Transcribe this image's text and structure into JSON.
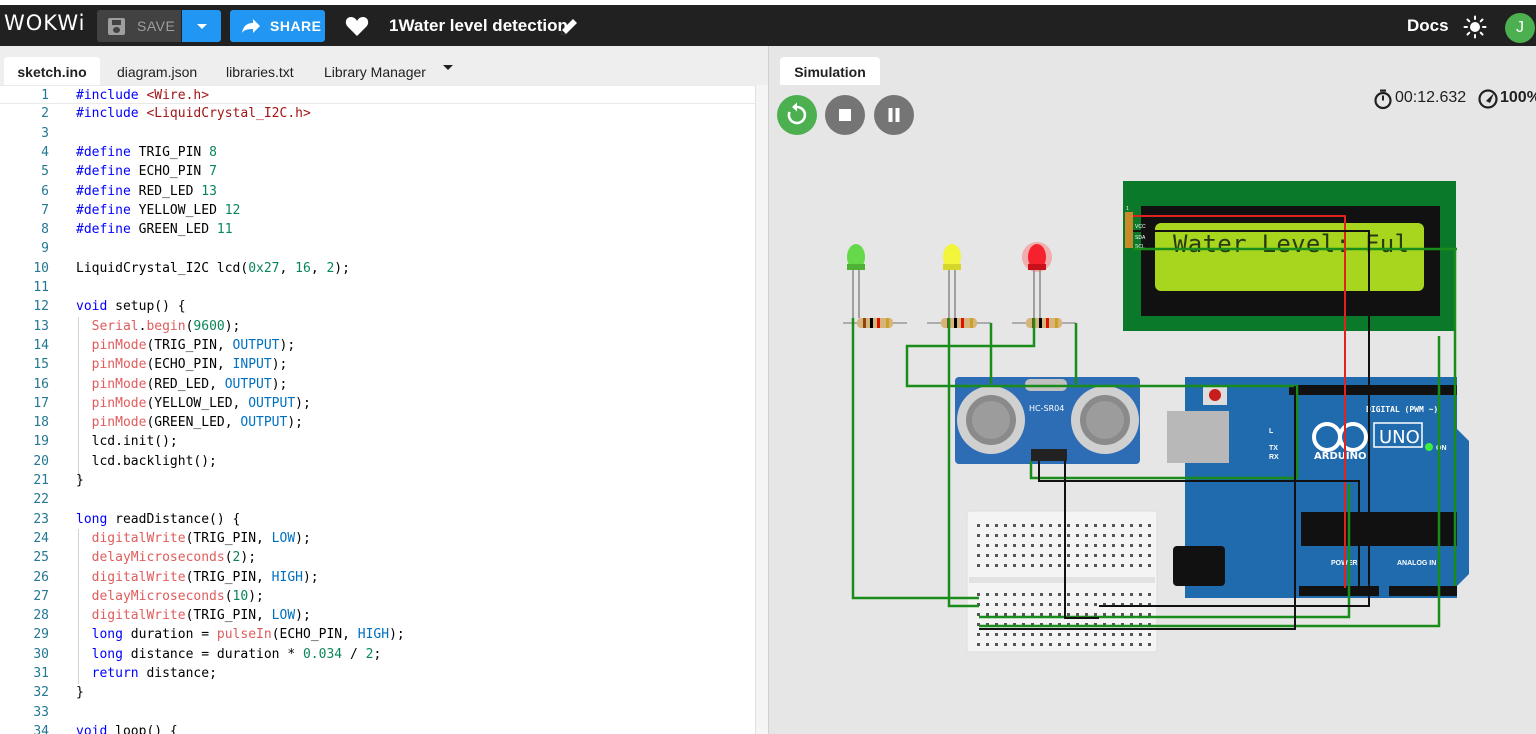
{
  "header": {
    "logo": "WOKWi",
    "save_label": "SAVE",
    "share_label": "SHARE",
    "project_title": "1Water level detection",
    "docs_label": "Docs",
    "avatar_initial": "J"
  },
  "editor": {
    "tabs": [
      {
        "label": "sketch.ino",
        "active": true
      },
      {
        "label": "diagram.json",
        "active": false
      },
      {
        "label": "libraries.txt",
        "active": false
      },
      {
        "label": "Library Manager",
        "active": false
      }
    ],
    "lines": [
      {
        "n": "1",
        "tokens": [
          [
            "pp",
            "#include "
          ],
          [
            "str",
            "<Wire.h>"
          ]
        ]
      },
      {
        "n": "2",
        "tokens": [
          [
            "pp",
            "#include "
          ],
          [
            "str",
            "<LiquidCrystal_I2C.h>"
          ]
        ]
      },
      {
        "n": "3",
        "tokens": []
      },
      {
        "n": "4",
        "tokens": [
          [
            "pp",
            "#define "
          ],
          [
            "plain",
            "TRIG_PIN "
          ],
          [
            "num",
            "8"
          ]
        ]
      },
      {
        "n": "5",
        "tokens": [
          [
            "pp",
            "#define "
          ],
          [
            "plain",
            "ECHO_PIN "
          ],
          [
            "num",
            "7"
          ]
        ]
      },
      {
        "n": "6",
        "tokens": [
          [
            "pp",
            "#define "
          ],
          [
            "plain",
            "RED_LED "
          ],
          [
            "num",
            "13"
          ]
        ]
      },
      {
        "n": "7",
        "tokens": [
          [
            "pp",
            "#define "
          ],
          [
            "plain",
            "YELLOW_LED "
          ],
          [
            "num",
            "12"
          ]
        ]
      },
      {
        "n": "8",
        "tokens": [
          [
            "pp",
            "#define "
          ],
          [
            "plain",
            "GREEN_LED "
          ],
          [
            "num",
            "11"
          ]
        ]
      },
      {
        "n": "9",
        "tokens": []
      },
      {
        "n": "10",
        "tokens": [
          [
            "plain",
            "LiquidCrystal_I2C lcd("
          ],
          [
            "num",
            "0x27"
          ],
          [
            "plain",
            ", "
          ],
          [
            "num",
            "16"
          ],
          [
            "plain",
            ", "
          ],
          [
            "num",
            "2"
          ],
          [
            "plain",
            ");"
          ]
        ]
      },
      {
        "n": "11",
        "tokens": []
      },
      {
        "n": "12",
        "tokens": [
          [
            "kw",
            "void "
          ],
          [
            "plain",
            "setup() {"
          ]
        ]
      },
      {
        "n": "13",
        "tokens": [
          [
            "plain",
            "  "
          ],
          [
            "fn",
            "Serial"
          ],
          [
            "plain",
            "."
          ],
          [
            "fn",
            "begin"
          ],
          [
            "plain",
            "("
          ],
          [
            "num",
            "9600"
          ],
          [
            "plain",
            ");"
          ]
        ]
      },
      {
        "n": "14",
        "tokens": [
          [
            "plain",
            "  "
          ],
          [
            "fn",
            "pinMode"
          ],
          [
            "plain",
            "(TRIG_PIN, "
          ],
          [
            "cst",
            "OUTPUT"
          ],
          [
            "plain",
            ");"
          ]
        ]
      },
      {
        "n": "15",
        "tokens": [
          [
            "plain",
            "  "
          ],
          [
            "fn",
            "pinMode"
          ],
          [
            "plain",
            "(ECHO_PIN, "
          ],
          [
            "cst",
            "INPUT"
          ],
          [
            "plain",
            ");"
          ]
        ]
      },
      {
        "n": "16",
        "tokens": [
          [
            "plain",
            "  "
          ],
          [
            "fn",
            "pinMode"
          ],
          [
            "plain",
            "(RED_LED, "
          ],
          [
            "cst",
            "OUTPUT"
          ],
          [
            "plain",
            ");"
          ]
        ]
      },
      {
        "n": "17",
        "tokens": [
          [
            "plain",
            "  "
          ],
          [
            "fn",
            "pinMode"
          ],
          [
            "plain",
            "(YELLOW_LED, "
          ],
          [
            "cst",
            "OUTPUT"
          ],
          [
            "plain",
            ");"
          ]
        ]
      },
      {
        "n": "18",
        "tokens": [
          [
            "plain",
            "  "
          ],
          [
            "fn",
            "pinMode"
          ],
          [
            "plain",
            "(GREEN_LED, "
          ],
          [
            "cst",
            "OUTPUT"
          ],
          [
            "plain",
            ");"
          ]
        ]
      },
      {
        "n": "19",
        "tokens": [
          [
            "plain",
            "  lcd.init();"
          ]
        ]
      },
      {
        "n": "20",
        "tokens": [
          [
            "plain",
            "  lcd.backlight();"
          ]
        ]
      },
      {
        "n": "21",
        "tokens": [
          [
            "plain",
            "}"
          ]
        ]
      },
      {
        "n": "22",
        "tokens": []
      },
      {
        "n": "23",
        "tokens": [
          [
            "kw",
            "long "
          ],
          [
            "plain",
            "readDistance() {"
          ]
        ]
      },
      {
        "n": "24",
        "tokens": [
          [
            "plain",
            "  "
          ],
          [
            "fn",
            "digitalWrite"
          ],
          [
            "plain",
            "(TRIG_PIN, "
          ],
          [
            "cst",
            "LOW"
          ],
          [
            "plain",
            ");"
          ]
        ]
      },
      {
        "n": "25",
        "tokens": [
          [
            "plain",
            "  "
          ],
          [
            "fn",
            "delayMicroseconds"
          ],
          [
            "plain",
            "("
          ],
          [
            "num",
            "2"
          ],
          [
            "plain",
            ");"
          ]
        ]
      },
      {
        "n": "26",
        "tokens": [
          [
            "plain",
            "  "
          ],
          [
            "fn",
            "digitalWrite"
          ],
          [
            "plain",
            "(TRIG_PIN, "
          ],
          [
            "cst",
            "HIGH"
          ],
          [
            "plain",
            ");"
          ]
        ]
      },
      {
        "n": "27",
        "tokens": [
          [
            "plain",
            "  "
          ],
          [
            "fn",
            "delayMicroseconds"
          ],
          [
            "plain",
            "("
          ],
          [
            "num",
            "10"
          ],
          [
            "plain",
            ");"
          ]
        ]
      },
      {
        "n": "28",
        "tokens": [
          [
            "plain",
            "  "
          ],
          [
            "fn",
            "digitalWrite"
          ],
          [
            "plain",
            "(TRIG_PIN, "
          ],
          [
            "cst",
            "LOW"
          ],
          [
            "plain",
            ");"
          ]
        ]
      },
      {
        "n": "29",
        "tokens": [
          [
            "plain",
            "  "
          ],
          [
            "kw",
            "long "
          ],
          [
            "plain",
            "duration = "
          ],
          [
            "fn",
            "pulseIn"
          ],
          [
            "plain",
            "(ECHO_PIN, "
          ],
          [
            "cst",
            "HIGH"
          ],
          [
            "plain",
            ");"
          ]
        ]
      },
      {
        "n": "30",
        "tokens": [
          [
            "plain",
            "  "
          ],
          [
            "kw",
            "long "
          ],
          [
            "plain",
            "distance = duration * "
          ],
          [
            "num",
            "0.034"
          ],
          [
            "plain",
            " / "
          ],
          [
            "num",
            "2"
          ],
          [
            "plain",
            ";"
          ]
        ]
      },
      {
        "n": "31",
        "tokens": [
          [
            "plain",
            "  "
          ],
          [
            "kw",
            "return "
          ],
          [
            "plain",
            "distance;"
          ]
        ]
      },
      {
        "n": "32",
        "tokens": [
          [
            "plain",
            "}"
          ]
        ]
      },
      {
        "n": "33",
        "tokens": []
      },
      {
        "n": "34",
        "tokens": [
          [
            "kw",
            "void "
          ],
          [
            "plain",
            "loop() {"
          ]
        ]
      }
    ]
  },
  "simulation": {
    "tab_label": "Simulation",
    "timer": "00:12.632",
    "speed": "100%",
    "lcd_text": "Water Level: Ful",
    "sensor_label": "HC-SR04",
    "board_brand": "ARDUINO",
    "board_model": "UNO",
    "board_digital_label": "DIGITAL (PWM ~)",
    "board_analog_label": "ANALOG IN",
    "board_power_label": "POWER",
    "board_tx": "TX",
    "board_rx": "RX",
    "board_l": "L",
    "board_on": "ON",
    "led_colors": {
      "green": "#66d94a",
      "yellow": "#f3f53a",
      "red": "#f5212d"
    },
    "lcd_pins": [
      "1",
      "VCC",
      "SDA",
      "SCL"
    ]
  },
  "colors": {
    "header_bg": "#212121",
    "accent_blue": "#2196f3",
    "run_green": "#4caf50",
    "control_gray": "#757575",
    "wire_green": "#1a8c1a",
    "wire_red": "#e0231e",
    "wire_black": "#111111"
  }
}
